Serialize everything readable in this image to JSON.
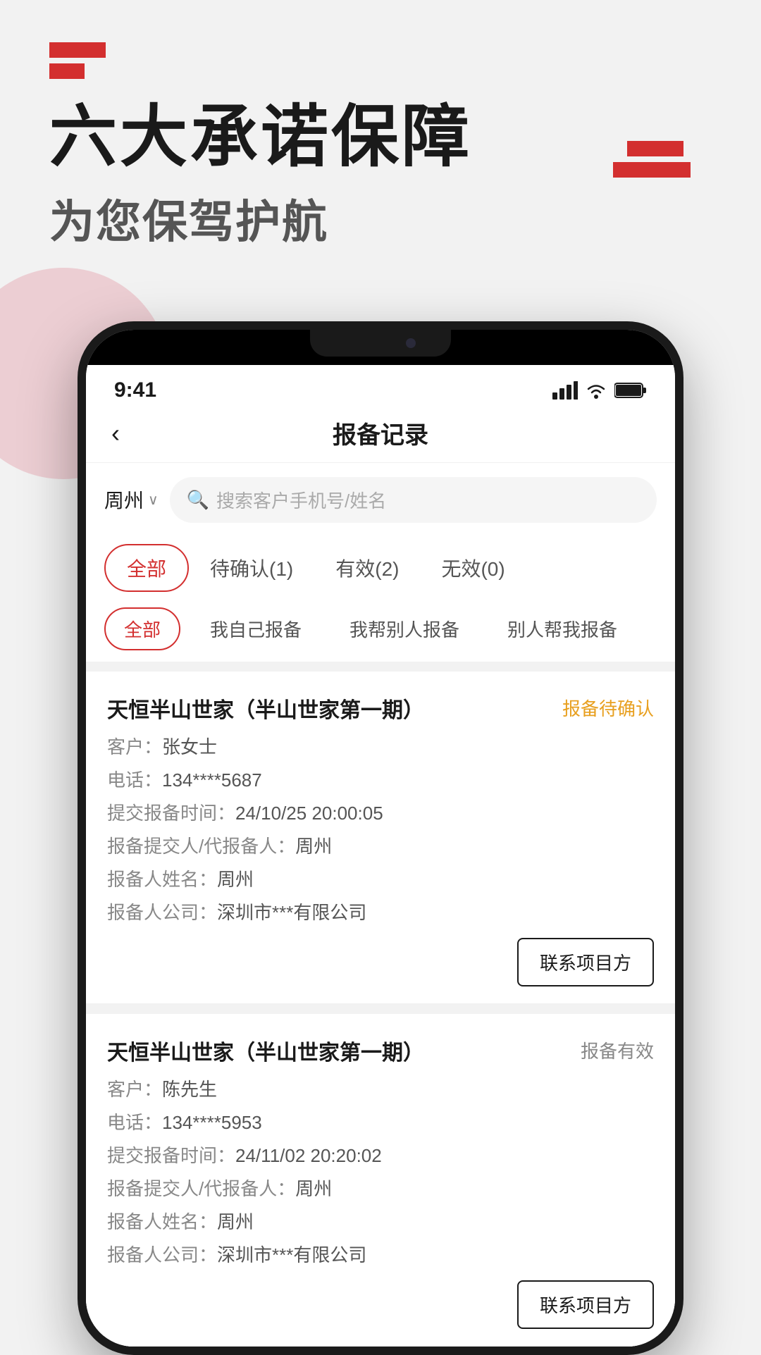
{
  "header": {
    "logo_bar1_visible": true,
    "headline": "六大承诺保障",
    "subheadline": "为您保驾护航"
  },
  "app": {
    "status_bar": {
      "time": "9:41"
    },
    "nav": {
      "back_icon": "‹",
      "title": "报备记录"
    },
    "search": {
      "city": "周州",
      "placeholder": "搜索客户手机号/姓名"
    },
    "tabs": {
      "main": [
        {
          "label": "全部",
          "active": true
        },
        {
          "label": "待确认(1)",
          "active": false
        },
        {
          "label": "有效(2)",
          "active": false
        },
        {
          "label": "无效(0)",
          "active": false
        }
      ],
      "sub": [
        {
          "label": "全部",
          "active": true
        },
        {
          "label": "我自己报备",
          "active": false
        },
        {
          "label": "我帮别人报备",
          "active": false
        },
        {
          "label": "别人帮我报备",
          "active": false
        }
      ]
    },
    "records": [
      {
        "title": "天恒半山世家（半山世家第一期）",
        "status": "报备待确认",
        "status_type": "pending",
        "customer_label": "客户：",
        "customer": "张女士",
        "phone_label": "电话：",
        "phone": "134****5687",
        "submit_time_label": "提交报备时间：",
        "submit_time": "24/10/25 20:00:05",
        "submitter_label": "报备提交人/代报备人：",
        "submitter": "周州",
        "registrant_label": "报备人姓名：",
        "registrant": "周州",
        "company_label": "报备人公司：",
        "company": "深圳市***有限公司",
        "contact_btn": "联系项目方"
      },
      {
        "title": "天恒半山世家（半山世家第一期）",
        "status": "报备有效",
        "status_type": "valid",
        "customer_label": "客户：",
        "customer": "陈先生",
        "phone_label": "电话：",
        "phone": "134****5953",
        "submit_time_label": "提交报备时间：",
        "submit_time": "24/11/02 20:20:02",
        "submitter_label": "报备提交人/代报备人：",
        "submitter": "周州",
        "registrant_label": "报备人姓名：",
        "registrant": "周州",
        "company_label": "报备人公司：",
        "company": "深圳市***有限公司",
        "contact_btn": "联系项目方"
      }
    ]
  }
}
